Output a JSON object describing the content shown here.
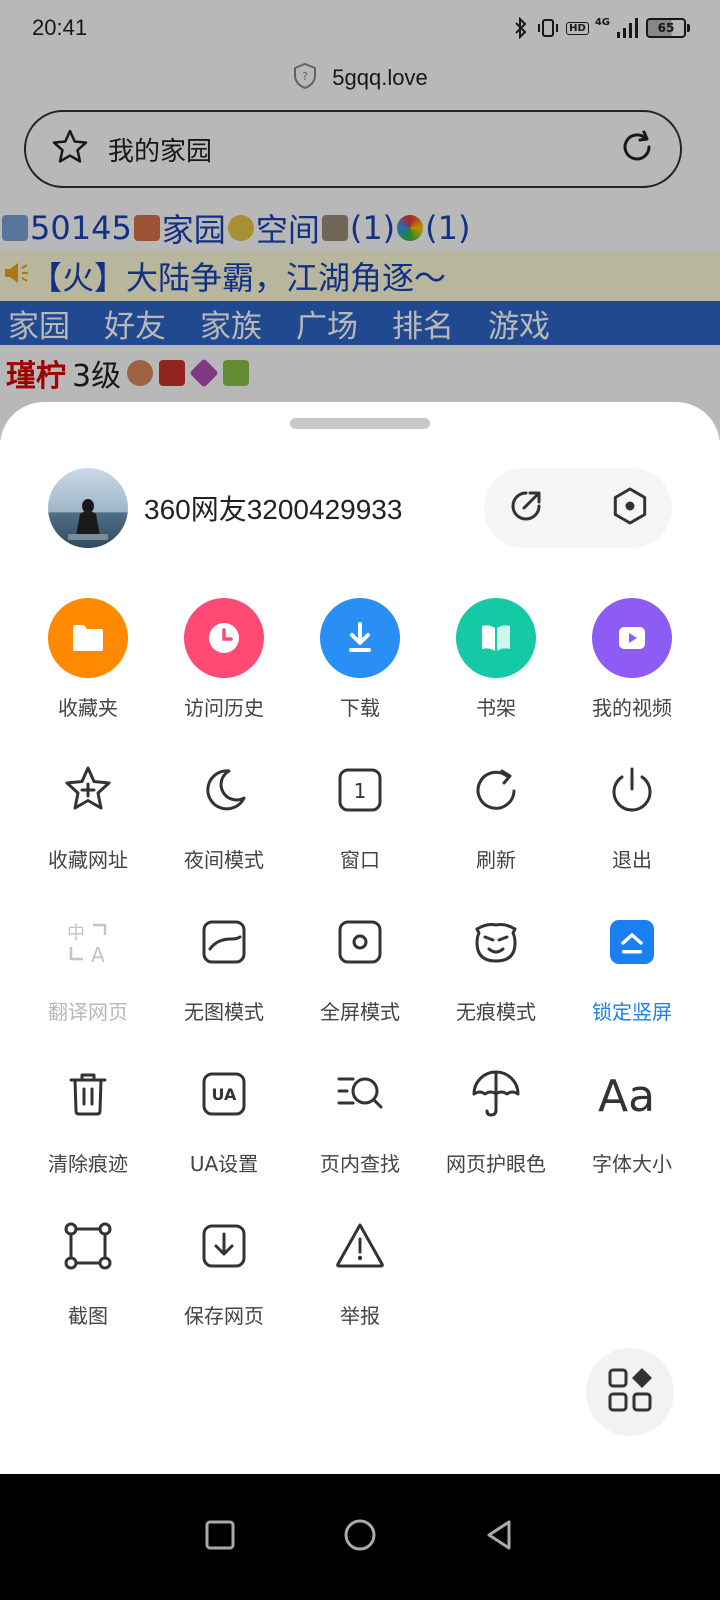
{
  "status": {
    "time": "20:41",
    "network": "4G",
    "hd": "HD",
    "battery": "65"
  },
  "browser": {
    "url": "5gqq.love",
    "page_title": "我的家园"
  },
  "web": {
    "count": "50145",
    "link1": "家园",
    "link2": "空间",
    "badge1": "(1)",
    "badge2": "(1)",
    "announcement": "【火】大陆争霸，江湖角逐～",
    "nav": [
      "家园",
      "好友",
      "家族",
      "广场",
      "排名",
      "游戏"
    ],
    "user_name": "瑾柠",
    "user_level": "3级"
  },
  "sheet": {
    "username": "360网友3200429933",
    "items": [
      {
        "label": "收藏夹",
        "icon": "folder-icon",
        "color": "#ff8a00"
      },
      {
        "label": "访问历史",
        "icon": "clock-icon",
        "color": "#ff4a73"
      },
      {
        "label": "下载",
        "icon": "download-icon",
        "color": "#2a8ff5"
      },
      {
        "label": "书架",
        "icon": "book-icon",
        "color": "#14c9a3"
      },
      {
        "label": "我的视频",
        "icon": "video-icon",
        "color": "#8c5cf5"
      },
      {
        "label": "收藏网址",
        "icon": "star-plus-icon"
      },
      {
        "label": "夜间模式",
        "icon": "moon-icon"
      },
      {
        "label": "窗口",
        "icon": "window-icon",
        "badge": "1"
      },
      {
        "label": "刷新",
        "icon": "refresh-icon"
      },
      {
        "label": "退出",
        "icon": "power-icon"
      },
      {
        "label": "翻译网页",
        "icon": "translate-icon",
        "translate_glyph": "中",
        "translate_glyph2": "A"
      },
      {
        "label": "无图模式",
        "icon": "no-image-icon"
      },
      {
        "label": "全屏模式",
        "icon": "fullscreen-icon"
      },
      {
        "label": "无痕模式",
        "icon": "incognito-icon"
      },
      {
        "label": "锁定竖屏",
        "icon": "lock-portrait-icon"
      },
      {
        "label": "清除痕迹",
        "icon": "trash-icon"
      },
      {
        "label": "UA设置",
        "icon": "ua-icon",
        "ua_text": "UA"
      },
      {
        "label": "页内查找",
        "icon": "find-in-page-icon"
      },
      {
        "label": "网页护眼色",
        "icon": "umbrella-icon"
      },
      {
        "label": "字体大小",
        "icon": "font-size-icon",
        "font_glyph": "Aa"
      },
      {
        "label": "截图",
        "icon": "screenshot-icon"
      },
      {
        "label": "保存网页",
        "icon": "save-page-icon"
      },
      {
        "label": "举报",
        "icon": "report-icon"
      }
    ]
  }
}
